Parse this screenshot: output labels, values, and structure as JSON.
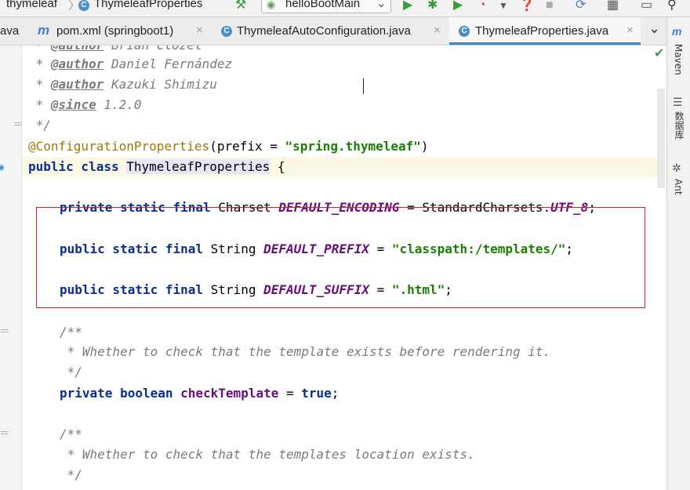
{
  "navbar": {
    "breadcrumb_project": "thymeleaf",
    "breadcrumb_class": "ThymeleafProperties",
    "run_config": "helloBootMain",
    "class_icon_letter": "C"
  },
  "tabs": [
    {
      "label": "ava",
      "active": false
    },
    {
      "label": "pom.xml (springboot1)",
      "icon": "m",
      "active": false
    },
    {
      "label": "ThymeleafAutoConfiguration.java",
      "icon": "C",
      "active": false
    },
    {
      "label": "ThymeleafProperties.java",
      "icon": "C",
      "active": true
    }
  ],
  "tab_close_glyph": "×",
  "tab_overflow_glyph": "⌄",
  "rightbar": {
    "maven": "Maven",
    "database": "数据库",
    "ant": "Ant"
  },
  "code": {
    "line_author1": {
      "star": " * ",
      "tag": "@author",
      "text": " Brian Clozel"
    },
    "line_author2": {
      "star": " * ",
      "tag": "@author",
      "text": " Daniel Fernández"
    },
    "line_author3": {
      "star": " * ",
      "tag": "@author",
      "text": " Kazuki Shimizu"
    },
    "line_since": {
      "star": " * ",
      "tag": "@since",
      "text": " 1.2.0"
    },
    "line_close": " */",
    "line_annotation": {
      "ann": "@ConfigurationProperties",
      "open": "(prefix = ",
      "value": "\"spring.thymeleaf\"",
      "close": ")"
    },
    "line_class": {
      "kw": "public class ",
      "name": "ThymeleafProperties",
      "brace": " {"
    },
    "line_encoding": {
      "kw": "private static final ",
      "type": "Charset ",
      "const": "DEFAULT_ENCODING",
      "eq": " = StandardCharsets.",
      "val": "UTF_8",
      "end": ";"
    },
    "line_prefix": {
      "kw": "public static final ",
      "type": "String ",
      "const": "DEFAULT_PREFIX",
      "eq": " = ",
      "val": "\"classpath:/templates/\"",
      "end": ";"
    },
    "line_suffix": {
      "kw": "public static final ",
      "type": "String ",
      "const": "DEFAULT_SUFFIX",
      "eq": " = ",
      "val": "\".html\"",
      "end": ";"
    },
    "doc1_open": "/**",
    "doc1_text": " * Whether to check that the template exists before rendering it.",
    "doc1_close": " */",
    "line_checkTemplate": {
      "kw": "private boolean ",
      "field": "checkTemplate",
      "eq": " = ",
      "val": "true",
      "end": ";"
    },
    "doc2_open": "/**",
    "doc2_text": " * Whether to check that the templates location exists.",
    "doc2_close": " */"
  },
  "colors": {
    "keyword": "#0a2d91",
    "string": "#1a7f00",
    "constant": "#660e7a",
    "annotation": "#9a7a00",
    "comment": "#7a7a7a",
    "highlight_box": "#d21f1f",
    "active_tab_underline": "#4083c9"
  }
}
